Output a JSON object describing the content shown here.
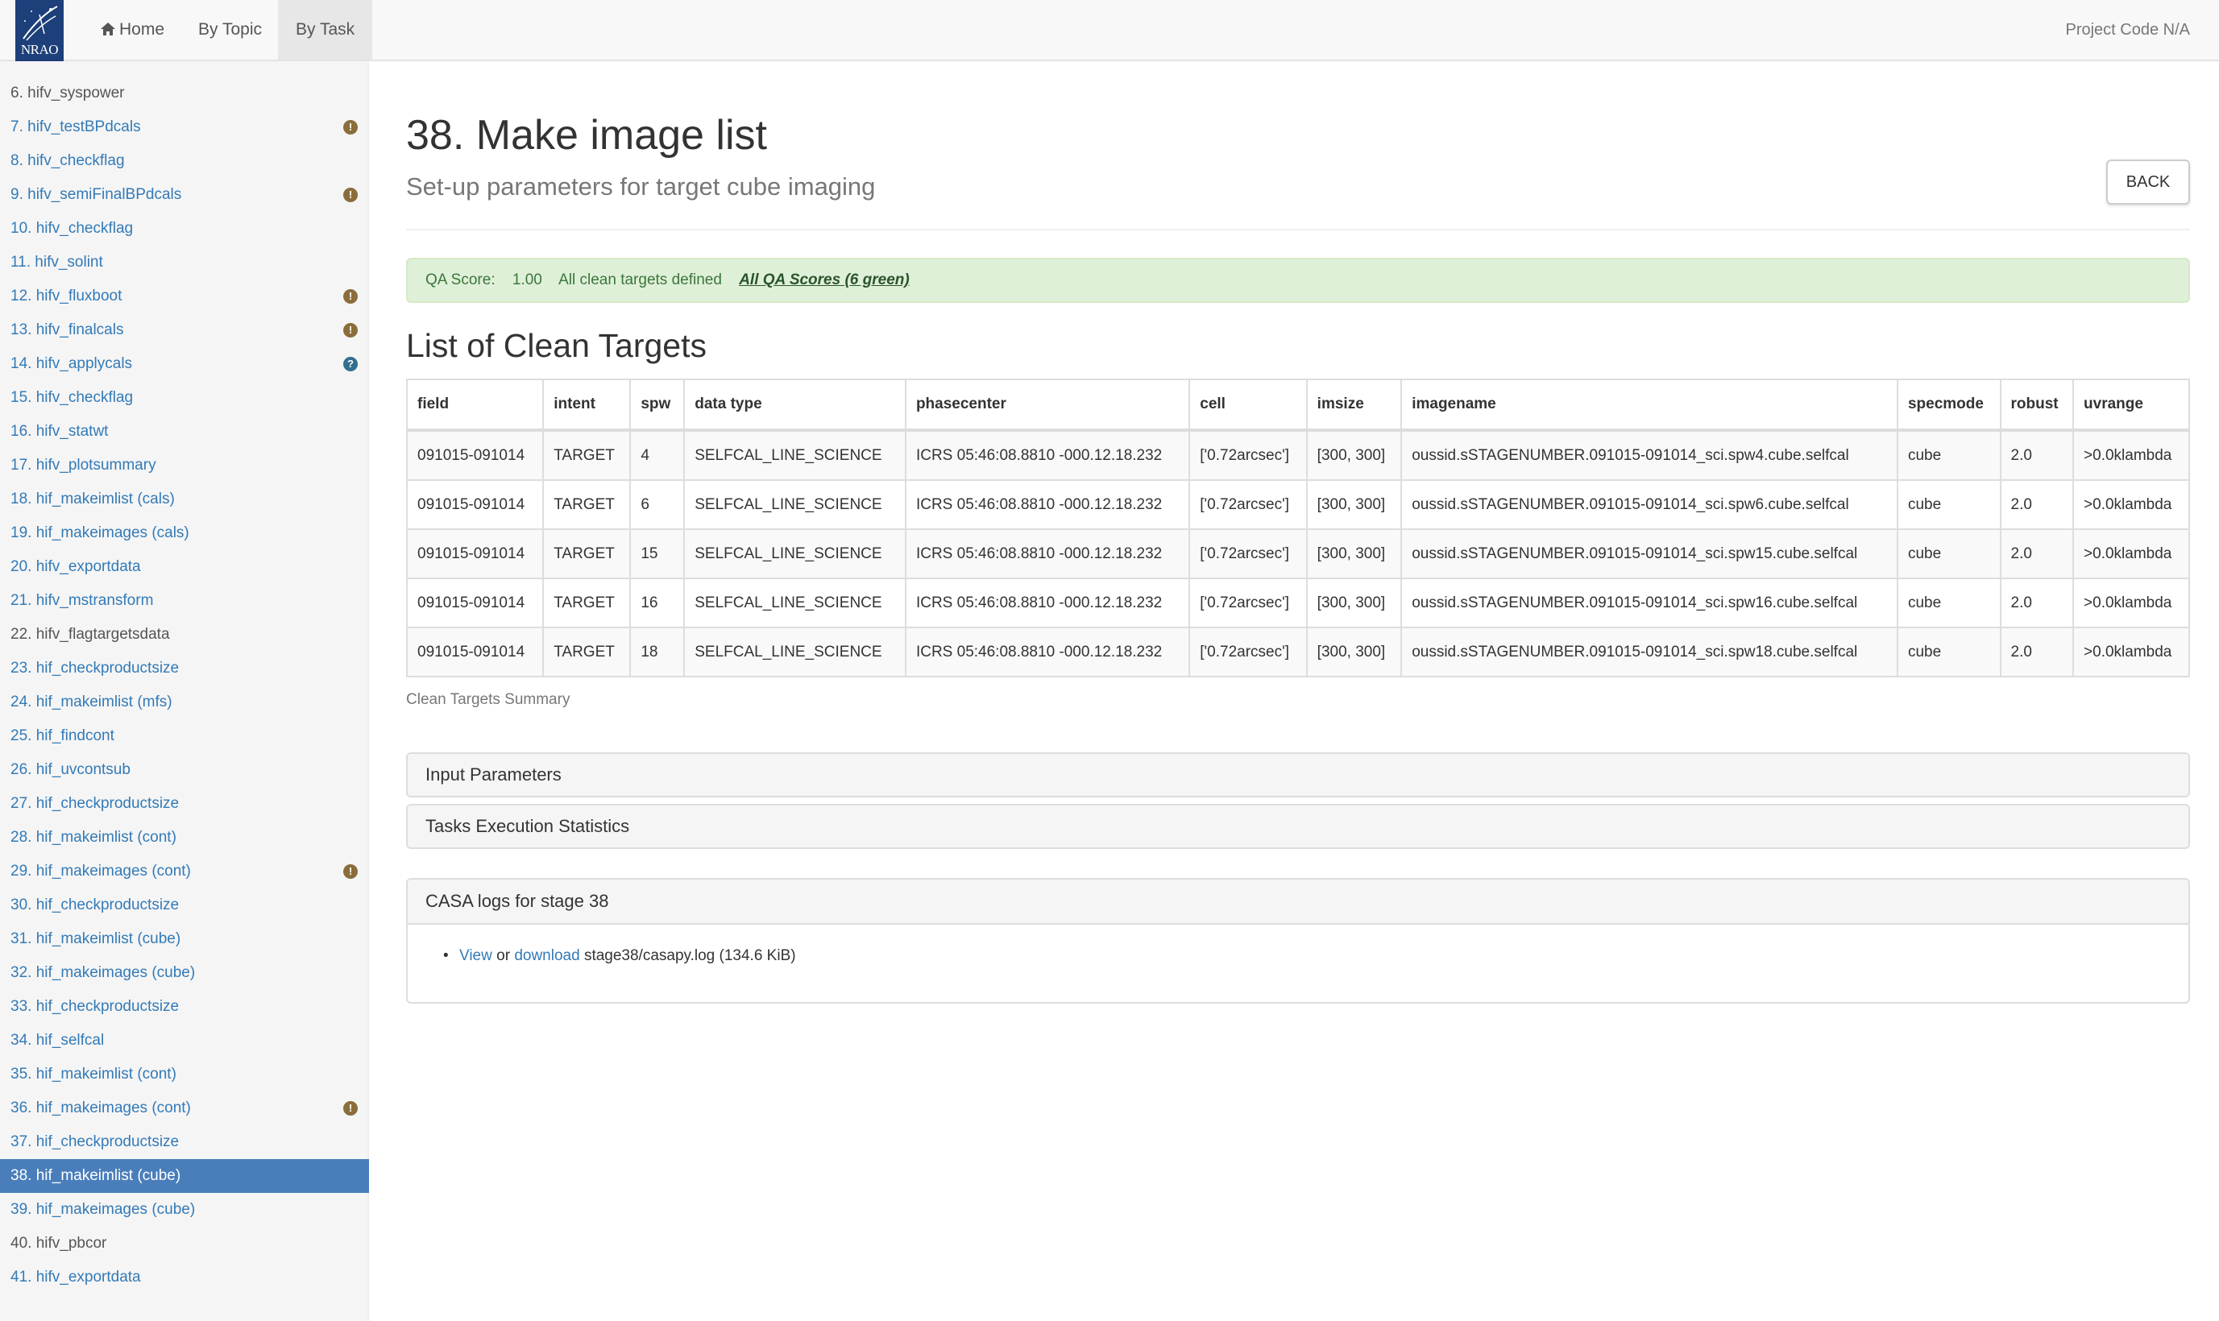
{
  "navbar": {
    "logo_text": "NRAO",
    "home_label": "Home",
    "by_topic_label": "By Topic",
    "by_task_label": "By Task",
    "project_code": "Project Code N/A"
  },
  "sidebar": {
    "items": [
      {
        "label": "6. hifv_syspower",
        "style": "plain",
        "badge": ""
      },
      {
        "label": "7. hifv_testBPdcals",
        "style": "link",
        "badge": "warning"
      },
      {
        "label": "8. hifv_checkflag",
        "style": "link",
        "badge": ""
      },
      {
        "label": "9. hifv_semiFinalBPdcals",
        "style": "link",
        "badge": "warning"
      },
      {
        "label": "10. hifv_checkflag",
        "style": "link",
        "badge": ""
      },
      {
        "label": "11. hifv_solint",
        "style": "link",
        "badge": ""
      },
      {
        "label": "12. hifv_fluxboot",
        "style": "link",
        "badge": "warning"
      },
      {
        "label": "13. hifv_finalcals",
        "style": "link",
        "badge": "warning"
      },
      {
        "label": "14. hifv_applycals",
        "style": "link",
        "badge": "info"
      },
      {
        "label": "15. hifv_checkflag",
        "style": "link",
        "badge": ""
      },
      {
        "label": "16. hifv_statwt",
        "style": "link",
        "badge": ""
      },
      {
        "label": "17. hifv_plotsummary",
        "style": "link",
        "badge": ""
      },
      {
        "label": "18. hif_makeimlist (cals)",
        "style": "link",
        "badge": ""
      },
      {
        "label": "19. hif_makeimages (cals)",
        "style": "link",
        "badge": ""
      },
      {
        "label": "20. hifv_exportdata",
        "style": "link",
        "badge": ""
      },
      {
        "label": "21. hifv_mstransform",
        "style": "link",
        "badge": ""
      },
      {
        "label": "22. hifv_flagtargetsdata",
        "style": "plain",
        "badge": ""
      },
      {
        "label": "23. hif_checkproductsize",
        "style": "link",
        "badge": ""
      },
      {
        "label": "24. hif_makeimlist (mfs)",
        "style": "link",
        "badge": ""
      },
      {
        "label": "25. hif_findcont",
        "style": "link",
        "badge": ""
      },
      {
        "label": "26. hif_uvcontsub",
        "style": "link",
        "badge": ""
      },
      {
        "label": "27. hif_checkproductsize",
        "style": "link",
        "badge": ""
      },
      {
        "label": "28. hif_makeimlist (cont)",
        "style": "link",
        "badge": ""
      },
      {
        "label": "29. hif_makeimages (cont)",
        "style": "link",
        "badge": "warning"
      },
      {
        "label": "30. hif_checkproductsize",
        "style": "link",
        "badge": ""
      },
      {
        "label": "31. hif_makeimlist (cube)",
        "style": "link",
        "badge": ""
      },
      {
        "label": "32. hif_makeimages (cube)",
        "style": "link",
        "badge": ""
      },
      {
        "label": "33. hif_checkproductsize",
        "style": "link",
        "badge": ""
      },
      {
        "label": "34. hif_selfcal",
        "style": "link",
        "badge": ""
      },
      {
        "label": "35. hif_makeimlist (cont)",
        "style": "link",
        "badge": ""
      },
      {
        "label": "36. hif_makeimages (cont)",
        "style": "link",
        "badge": "warning"
      },
      {
        "label": "37. hif_checkproductsize",
        "style": "link",
        "badge": ""
      },
      {
        "label": "38. hif_makeimlist (cube)",
        "style": "active",
        "badge": ""
      },
      {
        "label": "39. hif_makeimages (cube)",
        "style": "link",
        "badge": ""
      },
      {
        "label": "40. hifv_pbcor",
        "style": "plain",
        "badge": ""
      },
      {
        "label": "41. hifv_exportdata",
        "style": "link",
        "badge": ""
      }
    ]
  },
  "main": {
    "title": "38. Make image list",
    "subtitle": "Set-up parameters for target cube imaging",
    "back_label": "BACK",
    "qa": {
      "score_label": "QA Score:",
      "score_value": "1.00",
      "message": "All clean targets defined",
      "link": "All QA Scores (6 green)"
    },
    "section_title": "List of Clean Targets",
    "table": {
      "headers": [
        "field",
        "intent",
        "spw",
        "data type",
        "phasecenter",
        "cell",
        "imsize",
        "imagename",
        "specmode",
        "robust",
        "uvrange"
      ],
      "rows": [
        [
          "091015-091014",
          "TARGET",
          "4",
          "SELFCAL_LINE_SCIENCE",
          "ICRS 05:46:08.8810 -000.12.18.232",
          "['0.72arcsec']",
          "[300, 300]",
          "oussid.sSTAGENUMBER.091015-091014_sci.spw4.cube.selfcal",
          "cube",
          "2.0",
          ">0.0klambda"
        ],
        [
          "091015-091014",
          "TARGET",
          "6",
          "SELFCAL_LINE_SCIENCE",
          "ICRS 05:46:08.8810 -000.12.18.232",
          "['0.72arcsec']",
          "[300, 300]",
          "oussid.sSTAGENUMBER.091015-091014_sci.spw6.cube.selfcal",
          "cube",
          "2.0",
          ">0.0klambda"
        ],
        [
          "091015-091014",
          "TARGET",
          "15",
          "SELFCAL_LINE_SCIENCE",
          "ICRS 05:46:08.8810 -000.12.18.232",
          "['0.72arcsec']",
          "[300, 300]",
          "oussid.sSTAGENUMBER.091015-091014_sci.spw15.cube.selfcal",
          "cube",
          "2.0",
          ">0.0klambda"
        ],
        [
          "091015-091014",
          "TARGET",
          "16",
          "SELFCAL_LINE_SCIENCE",
          "ICRS 05:46:08.8810 -000.12.18.232",
          "['0.72arcsec']",
          "[300, 300]",
          "oussid.sSTAGENUMBER.091015-091014_sci.spw16.cube.selfcal",
          "cube",
          "2.0",
          ">0.0klambda"
        ],
        [
          "091015-091014",
          "TARGET",
          "18",
          "SELFCAL_LINE_SCIENCE",
          "ICRS 05:46:08.8810 -000.12.18.232",
          "['0.72arcsec']",
          "[300, 300]",
          "oussid.sSTAGENUMBER.091015-091014_sci.spw18.cube.selfcal",
          "cube",
          "2.0",
          ">0.0klambda"
        ]
      ],
      "caption": "Clean Targets Summary"
    },
    "panels": {
      "input_parameters": "Input Parameters",
      "execution_stats": "Tasks Execution Statistics",
      "casa_logs": "CASA logs for stage 38"
    },
    "log": {
      "view_label": "View",
      "or_text": "or",
      "download_label": "download",
      "file": "stage38/casapy.log (134.6 KiB)"
    }
  },
  "colors": {
    "active_item": "#4a7ebb",
    "link": "#337ab7",
    "qa_background": "#dff0d8",
    "qa_text": "#3c763d",
    "warning_badge": "#8a6d3b",
    "info_badge": "#31708f"
  }
}
